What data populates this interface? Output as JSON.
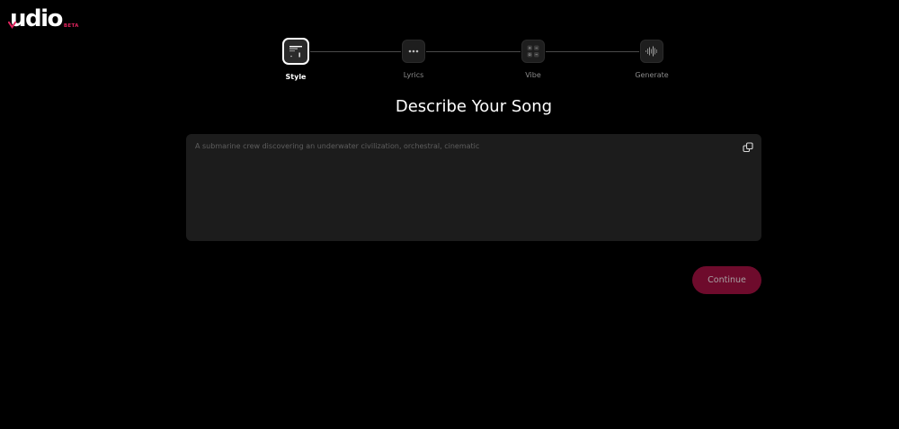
{
  "brand": {
    "name": "udio",
    "badge": "BETA",
    "accent_color": "#e0245e"
  },
  "stepper": {
    "steps": [
      {
        "label": "Style",
        "icon": "style-card-icon",
        "active": true
      },
      {
        "label": "Lyrics",
        "icon": "dots-icon",
        "active": false
      },
      {
        "label": "Vibe",
        "icon": "grid-icon",
        "active": false
      },
      {
        "label": "Generate",
        "icon": "waveform-icon",
        "active": false
      }
    ]
  },
  "main": {
    "heading": "Describe Your Song",
    "prompt_placeholder": "A submarine crew discovering an underwater civilization, orchestral, cinematic",
    "prompt_value": "",
    "copy_icon": "copy-link-icon",
    "continue_label": "Continue",
    "continue_color": "#6e0b2c"
  }
}
